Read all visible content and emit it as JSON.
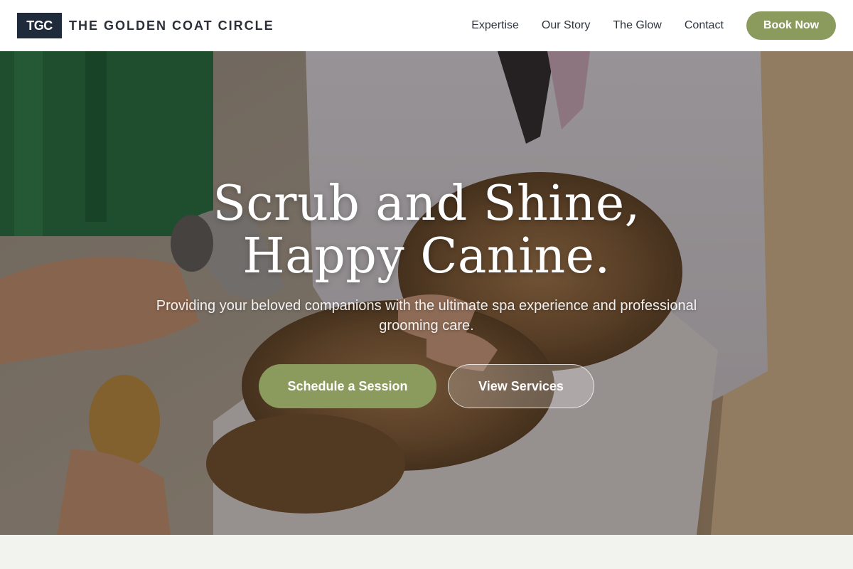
{
  "header": {
    "logo_mark": "TGC",
    "brand_name": "THE GOLDEN COAT CIRCLE",
    "nav": [
      {
        "label": "Expertise"
      },
      {
        "label": "Our Story"
      },
      {
        "label": "The Glow"
      },
      {
        "label": "Contact"
      }
    ],
    "cta_label": "Book Now"
  },
  "hero": {
    "title": "Scrub and Shine, Happy Canine.",
    "subtitle": "Providing your beloved companions with the ultimate spa experience and professional grooming care.",
    "primary_button": "Schedule a Session",
    "secondary_button": "View Services",
    "image_description": "dog-grooming-photo"
  },
  "colors": {
    "accent": "#8b9b5e",
    "logo_bg": "#1f2a3a",
    "section_bg": "#f2f3ef"
  }
}
